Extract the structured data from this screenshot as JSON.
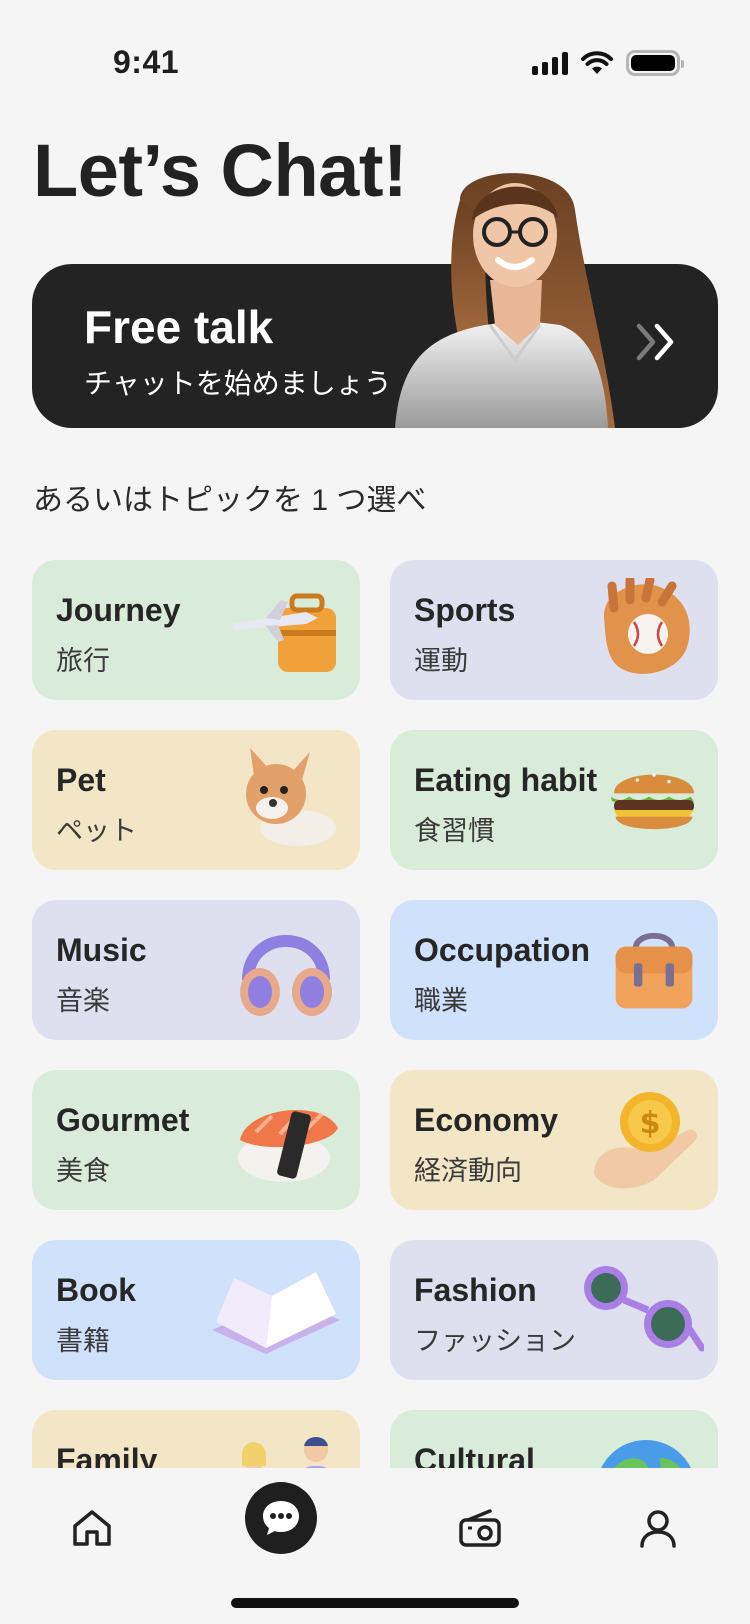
{
  "status_bar": {
    "time": "9:41"
  },
  "page": {
    "title": "Let’s Chat!"
  },
  "free_talk": {
    "title": "Free talk",
    "subtitle": "チャットを始めましょう"
  },
  "section_label": "あるいはトピックを 1 つ選べ",
  "topics": [
    {
      "title": "Journey",
      "subtitle": "旅行",
      "color": "#d9ebd9",
      "icon": "plane-suitcase-icon"
    },
    {
      "title": "Sports",
      "subtitle": "運動",
      "color": "#dfe0ef",
      "icon": "baseball-glove-icon"
    },
    {
      "title": "Pet",
      "subtitle": "ペット",
      "color": "#f3e6c6",
      "icon": "dog-icon"
    },
    {
      "title": "Eating habit",
      "subtitle": "食習慣",
      "color": "#d9ebd9",
      "icon": "burger-icon"
    },
    {
      "title": "Music",
      "subtitle": "音楽",
      "color": "#dfe0ef",
      "icon": "headphones-icon"
    },
    {
      "title": "Occupation",
      "subtitle": "職業",
      "color": "#cfe1fb",
      "icon": "briefcase-icon"
    },
    {
      "title": "Gourmet",
      "subtitle": "美食",
      "color": "#d9ebd9",
      "icon": "sushi-icon"
    },
    {
      "title": "Economy",
      "subtitle": "経済動向",
      "color": "#f3e6c6",
      "icon": "coin-hand-icon"
    },
    {
      "title": "Book",
      "subtitle": "書籍",
      "color": "#cfe1fb",
      "icon": "open-book-icon"
    },
    {
      "title": "Fashion",
      "subtitle": "ファッション",
      "color": "#dfe0ef",
      "icon": "sunglasses-icon"
    },
    {
      "title": "Family",
      "subtitle": "",
      "color": "#f3e6c6",
      "icon": "family-icon"
    },
    {
      "title": "Cultural",
      "subtitle": "",
      "color": "#d9ebd9",
      "icon": "globe-icon"
    }
  ],
  "nav": {
    "items": [
      "home-icon",
      "chat-icon",
      "radio-icon",
      "profile-icon"
    ],
    "active": "chat-icon"
  }
}
